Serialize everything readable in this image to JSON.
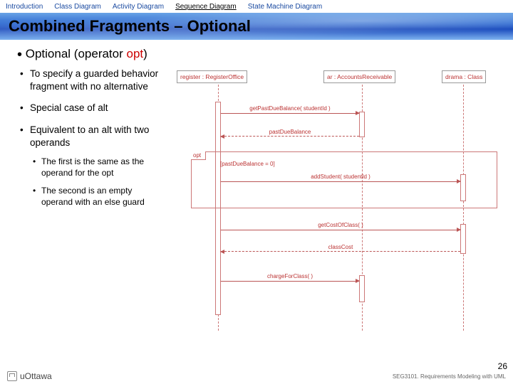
{
  "tabs": {
    "introduction": "Introduction",
    "class": "Class Diagram",
    "activity": "Activity Diagram",
    "sequence": "Sequence Diagram",
    "state": "State Machine Diagram"
  },
  "title": "Combined Fragments – Optional",
  "bullet1_pre": "Optional (operator ",
  "bullet1_op": "opt",
  "bullet1_post": ")",
  "b2_1": "To specify a guarded behavior fragment with no alternative",
  "b2_2": "Special case of alt",
  "b2_3": "Equivalent to an alt with two operands",
  "b3_1": "The first is the same as the operand for the opt",
  "b3_2": "The second is an empty operand with an else guard",
  "diagram": {
    "lifeline1": "register : RegisterOffice",
    "lifeline2": "ar : AccountsReceivable",
    "lifeline3": "drama : Class",
    "msg_getPastDue": "getPastDueBalance( studentId )",
    "ret_pastDue": "pastDueBalance",
    "opt_label": "opt",
    "guard": "[pastDueBalance = 0]",
    "msg_addStudent": "addStudent( studentId )",
    "msg_getCost": "getCostOfClass( )",
    "ret_cost": "classCost",
    "msg_charge": "chargeForClass( )"
  },
  "footer_course": "SEG3101. Requirements Modeling with UML",
  "footer_uni": "uOttawa",
  "page_no": "26"
}
